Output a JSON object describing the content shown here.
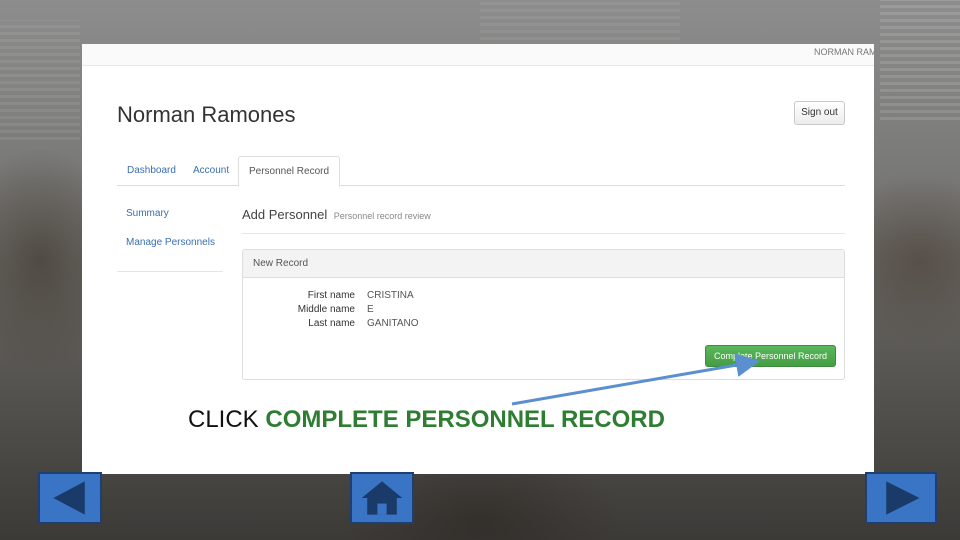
{
  "topbar": {
    "user": "NORMAN RAMONES"
  },
  "app": {
    "title": "Norman Ramones",
    "signout_label": "Sign out"
  },
  "tabs": [
    {
      "label": "Dashboard"
    },
    {
      "label": "Account"
    },
    {
      "label": "Personnel Record"
    }
  ],
  "sidebar": {
    "items": [
      {
        "label": "Summary"
      },
      {
        "label": "Manage Personnels"
      }
    ]
  },
  "section": {
    "title": "Add Personnel",
    "subtitle": "Personnel record review"
  },
  "card": {
    "heading": "New Record",
    "fields": [
      {
        "label": "First name",
        "value": "CRISTINA"
      },
      {
        "label": "Middle name",
        "value": "E"
      },
      {
        "label": "Last name",
        "value": "GANITANO"
      }
    ],
    "complete_label": "Complete Personnel Record"
  },
  "caption": {
    "prefix": "CLICK",
    "highlight": "COMPLETE PERSONNEL RECORD"
  },
  "colors": {
    "accent_green": "#2e7d32",
    "nav_blue": "#3a74c4",
    "button_green": "#5cb85c"
  },
  "icons": {
    "prev": "left-triangle-icon",
    "home": "home-icon",
    "next": "right-triangle-icon"
  }
}
